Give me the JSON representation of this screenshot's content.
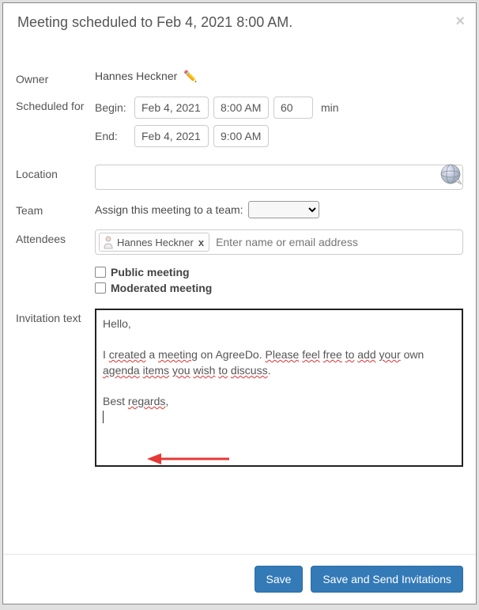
{
  "title": "Meeting scheduled to Feb 4, 2021 8:00 AM.",
  "labels": {
    "owner": "Owner",
    "scheduled_for": "Scheduled for",
    "begin": "Begin:",
    "end": "End:",
    "min": "min",
    "location": "Location",
    "team": "Team",
    "team_assign": "Assign this meeting to a team:",
    "attendees": "Attendees",
    "public_meeting": "Public meeting",
    "moderated_meeting": "Moderated meeting",
    "invitation_text": "Invitation text"
  },
  "owner_name": "Hannes Heckner",
  "schedule": {
    "begin_date": "Feb 4, 2021",
    "begin_time": "8:00 AM",
    "duration": "60",
    "end_date": "Feb 4, 2021",
    "end_time": "9:00 AM"
  },
  "location": "",
  "team_selected": "",
  "attendees": [
    {
      "name": "Hannes Heckner"
    }
  ],
  "attendee_placeholder": "Enter name or email address",
  "invitation": {
    "line1": "Hello,",
    "line2a": "I ",
    "w_created": "created",
    "line2b": " a ",
    "w_meeting": "meeting",
    "line2c": " on AgreeDo. ",
    "w_please": "Please",
    "sp": " ",
    "w_feel": "feel",
    "w_free": "free",
    "w_to": "to",
    "w_add": "add",
    "w_your": "your",
    "line2d": " own ",
    "w_agenda": "agenda",
    "w_items": "items",
    "w_you": "you",
    "w_wish": "wish",
    "w_discuss": "discuss",
    "period": ".",
    "line3a": "Best ",
    "w_regards": "regards",
    "comma": ","
  },
  "buttons": {
    "save": "Save",
    "save_send": "Save and Send Invitations"
  }
}
